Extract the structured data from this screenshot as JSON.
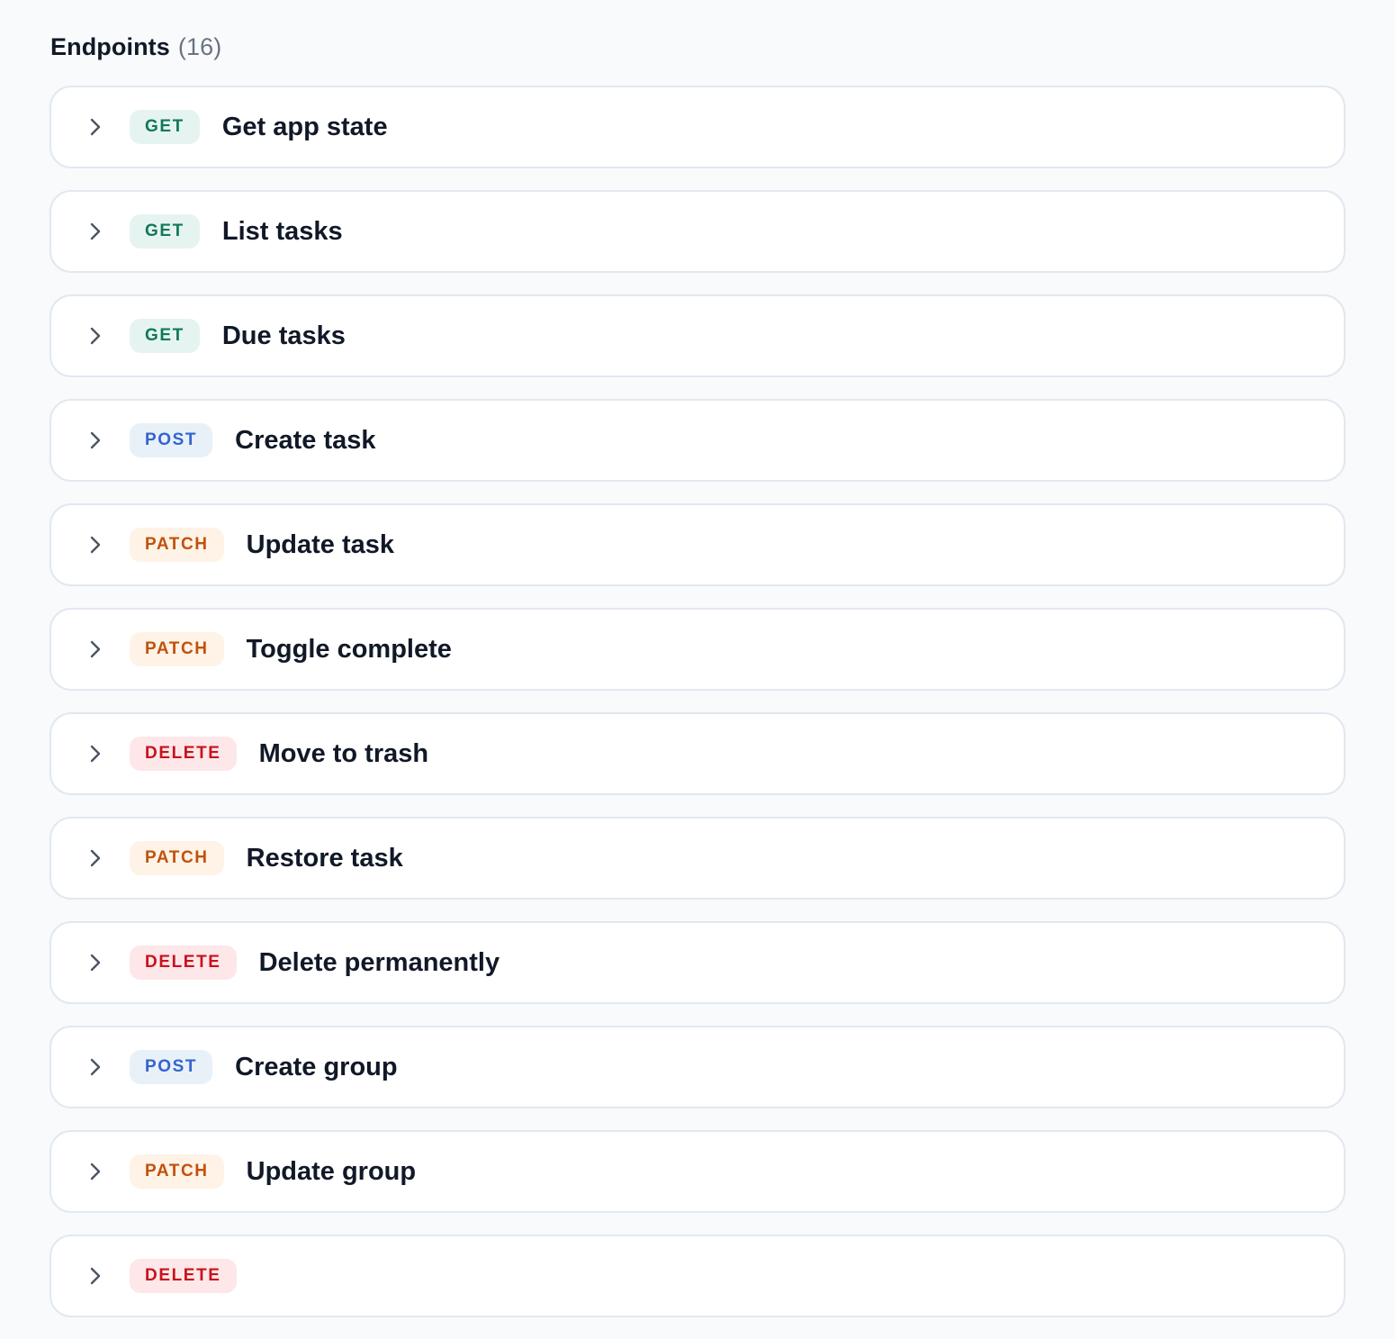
{
  "header": {
    "title": "Endpoints",
    "count": "(16)"
  },
  "endpoints": [
    {
      "method": "GET",
      "title": "Get app state"
    },
    {
      "method": "GET",
      "title": "List tasks"
    },
    {
      "method": "GET",
      "title": "Due tasks"
    },
    {
      "method": "POST",
      "title": "Create task"
    },
    {
      "method": "PATCH",
      "title": "Update task"
    },
    {
      "method": "PATCH",
      "title": "Toggle complete"
    },
    {
      "method": "DELETE",
      "title": "Move to trash"
    },
    {
      "method": "PATCH",
      "title": "Restore task"
    },
    {
      "method": "DELETE",
      "title": "Delete permanently"
    },
    {
      "method": "POST",
      "title": "Create group"
    },
    {
      "method": "PATCH",
      "title": "Update group"
    },
    {
      "method": "DELETE",
      "title": ""
    }
  ],
  "method_colors": {
    "GET": {
      "bg": "#e6f4f1",
      "fg": "#11785a"
    },
    "POST": {
      "bg": "#e8f1f8",
      "fg": "#3463d1"
    },
    "PATCH": {
      "bg": "#fef3e6",
      "fg": "#c2510c"
    },
    "DELETE": {
      "bg": "#fde7e9",
      "fg": "#c8121c"
    }
  },
  "icons": {
    "row_toggle": "chevron-right-icon"
  }
}
